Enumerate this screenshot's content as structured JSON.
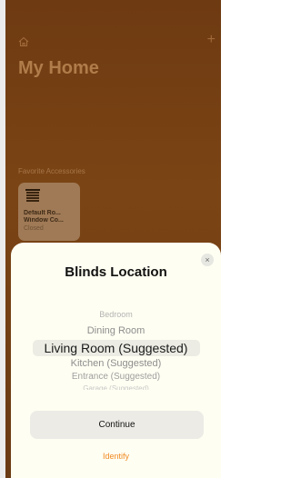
{
  "home": {
    "title": "My Home",
    "favorites_label": "Favorite Accessories",
    "accessory": {
      "name_line1": "Default Ro...",
      "name_line2": "Window Co...",
      "status": "Closed"
    }
  },
  "sheet": {
    "title": "Blinds Location",
    "close_glyph": "×",
    "picker": {
      "items": [
        "Bedroom",
        "Dining Room",
        "Living Room (Suggested)",
        "Kitchen (Suggested)",
        "Entrance (Suggested)",
        "Garage (Suggested)"
      ],
      "selected": "Living Room (Suggested)"
    },
    "continue_label": "Continue",
    "identify_label": "Identify"
  },
  "colors": {
    "accent": "#f08a24",
    "background": "#6e3a12"
  }
}
